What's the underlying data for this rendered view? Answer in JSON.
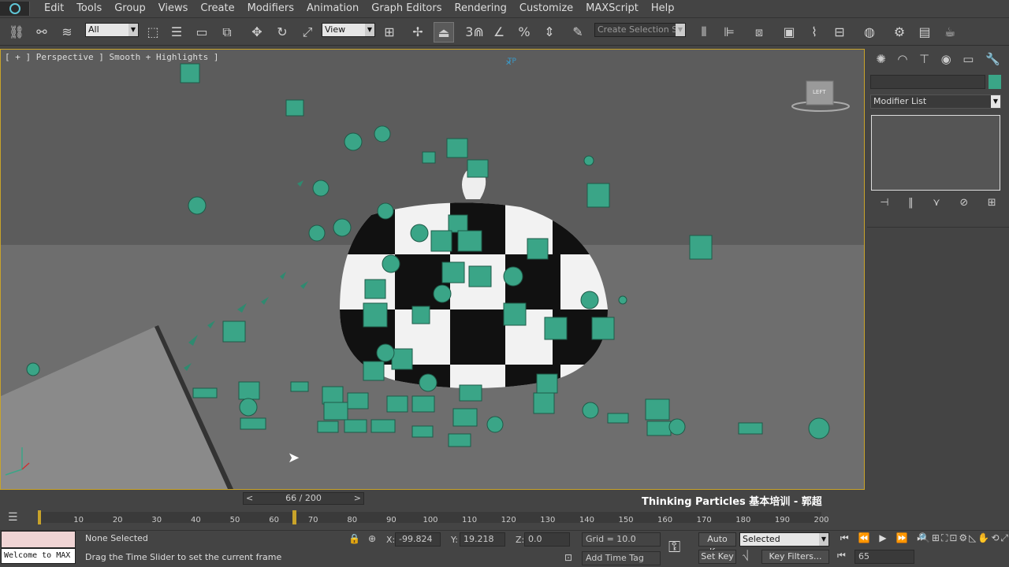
{
  "menu": [
    "Edit",
    "Tools",
    "Group",
    "Views",
    "Create",
    "Modifiers",
    "Animation",
    "Graph Editors",
    "Rendering",
    "Customize",
    "MAXScript",
    "Help"
  ],
  "toolbar": {
    "selection_filter": "All",
    "ref_coord": "View",
    "named_selection": "Create Selection Se",
    "snap_label": "3"
  },
  "viewport": {
    "label": "[ + ] Perspective ] Smooth + Highlights ]",
    "tp_tag": "TP",
    "viewcube_label": "LEFT"
  },
  "cmdpanel": {
    "modifier_list": "Modifier List"
  },
  "timeline": {
    "current": 66,
    "total": 200,
    "slider_text": "66 / 200",
    "ticks": [
      "10",
      "20",
      "30",
      "40",
      "50",
      "60",
      "70",
      "80",
      "90",
      "100",
      "110",
      "120",
      "130",
      "140",
      "150",
      "160",
      "170",
      "180",
      "190",
      "200"
    ]
  },
  "watermark": "Thinking Particles 基本培训 - 郭超",
  "status": {
    "listener": "Welcome to MAX",
    "selection": "None Selected",
    "prompt": "Drag the Time Slider to set the current frame",
    "x_label": "X:",
    "x_value": "-99.824",
    "y_label": "Y:",
    "y_value": "19.218",
    "z_label": "Z:",
    "z_value": "0.0",
    "grid": "Grid = 10.0",
    "add_time_tag": "Add Time Tag",
    "auto_key": "Auto Key",
    "set_key": "Set Key",
    "selected": "Selected",
    "key_filters": "Key Filters...",
    "frame": "65"
  },
  "colors": {
    "accent": "#c8a32a",
    "particle": "#3aa587",
    "viewport_bg": "#5c5c5c"
  }
}
